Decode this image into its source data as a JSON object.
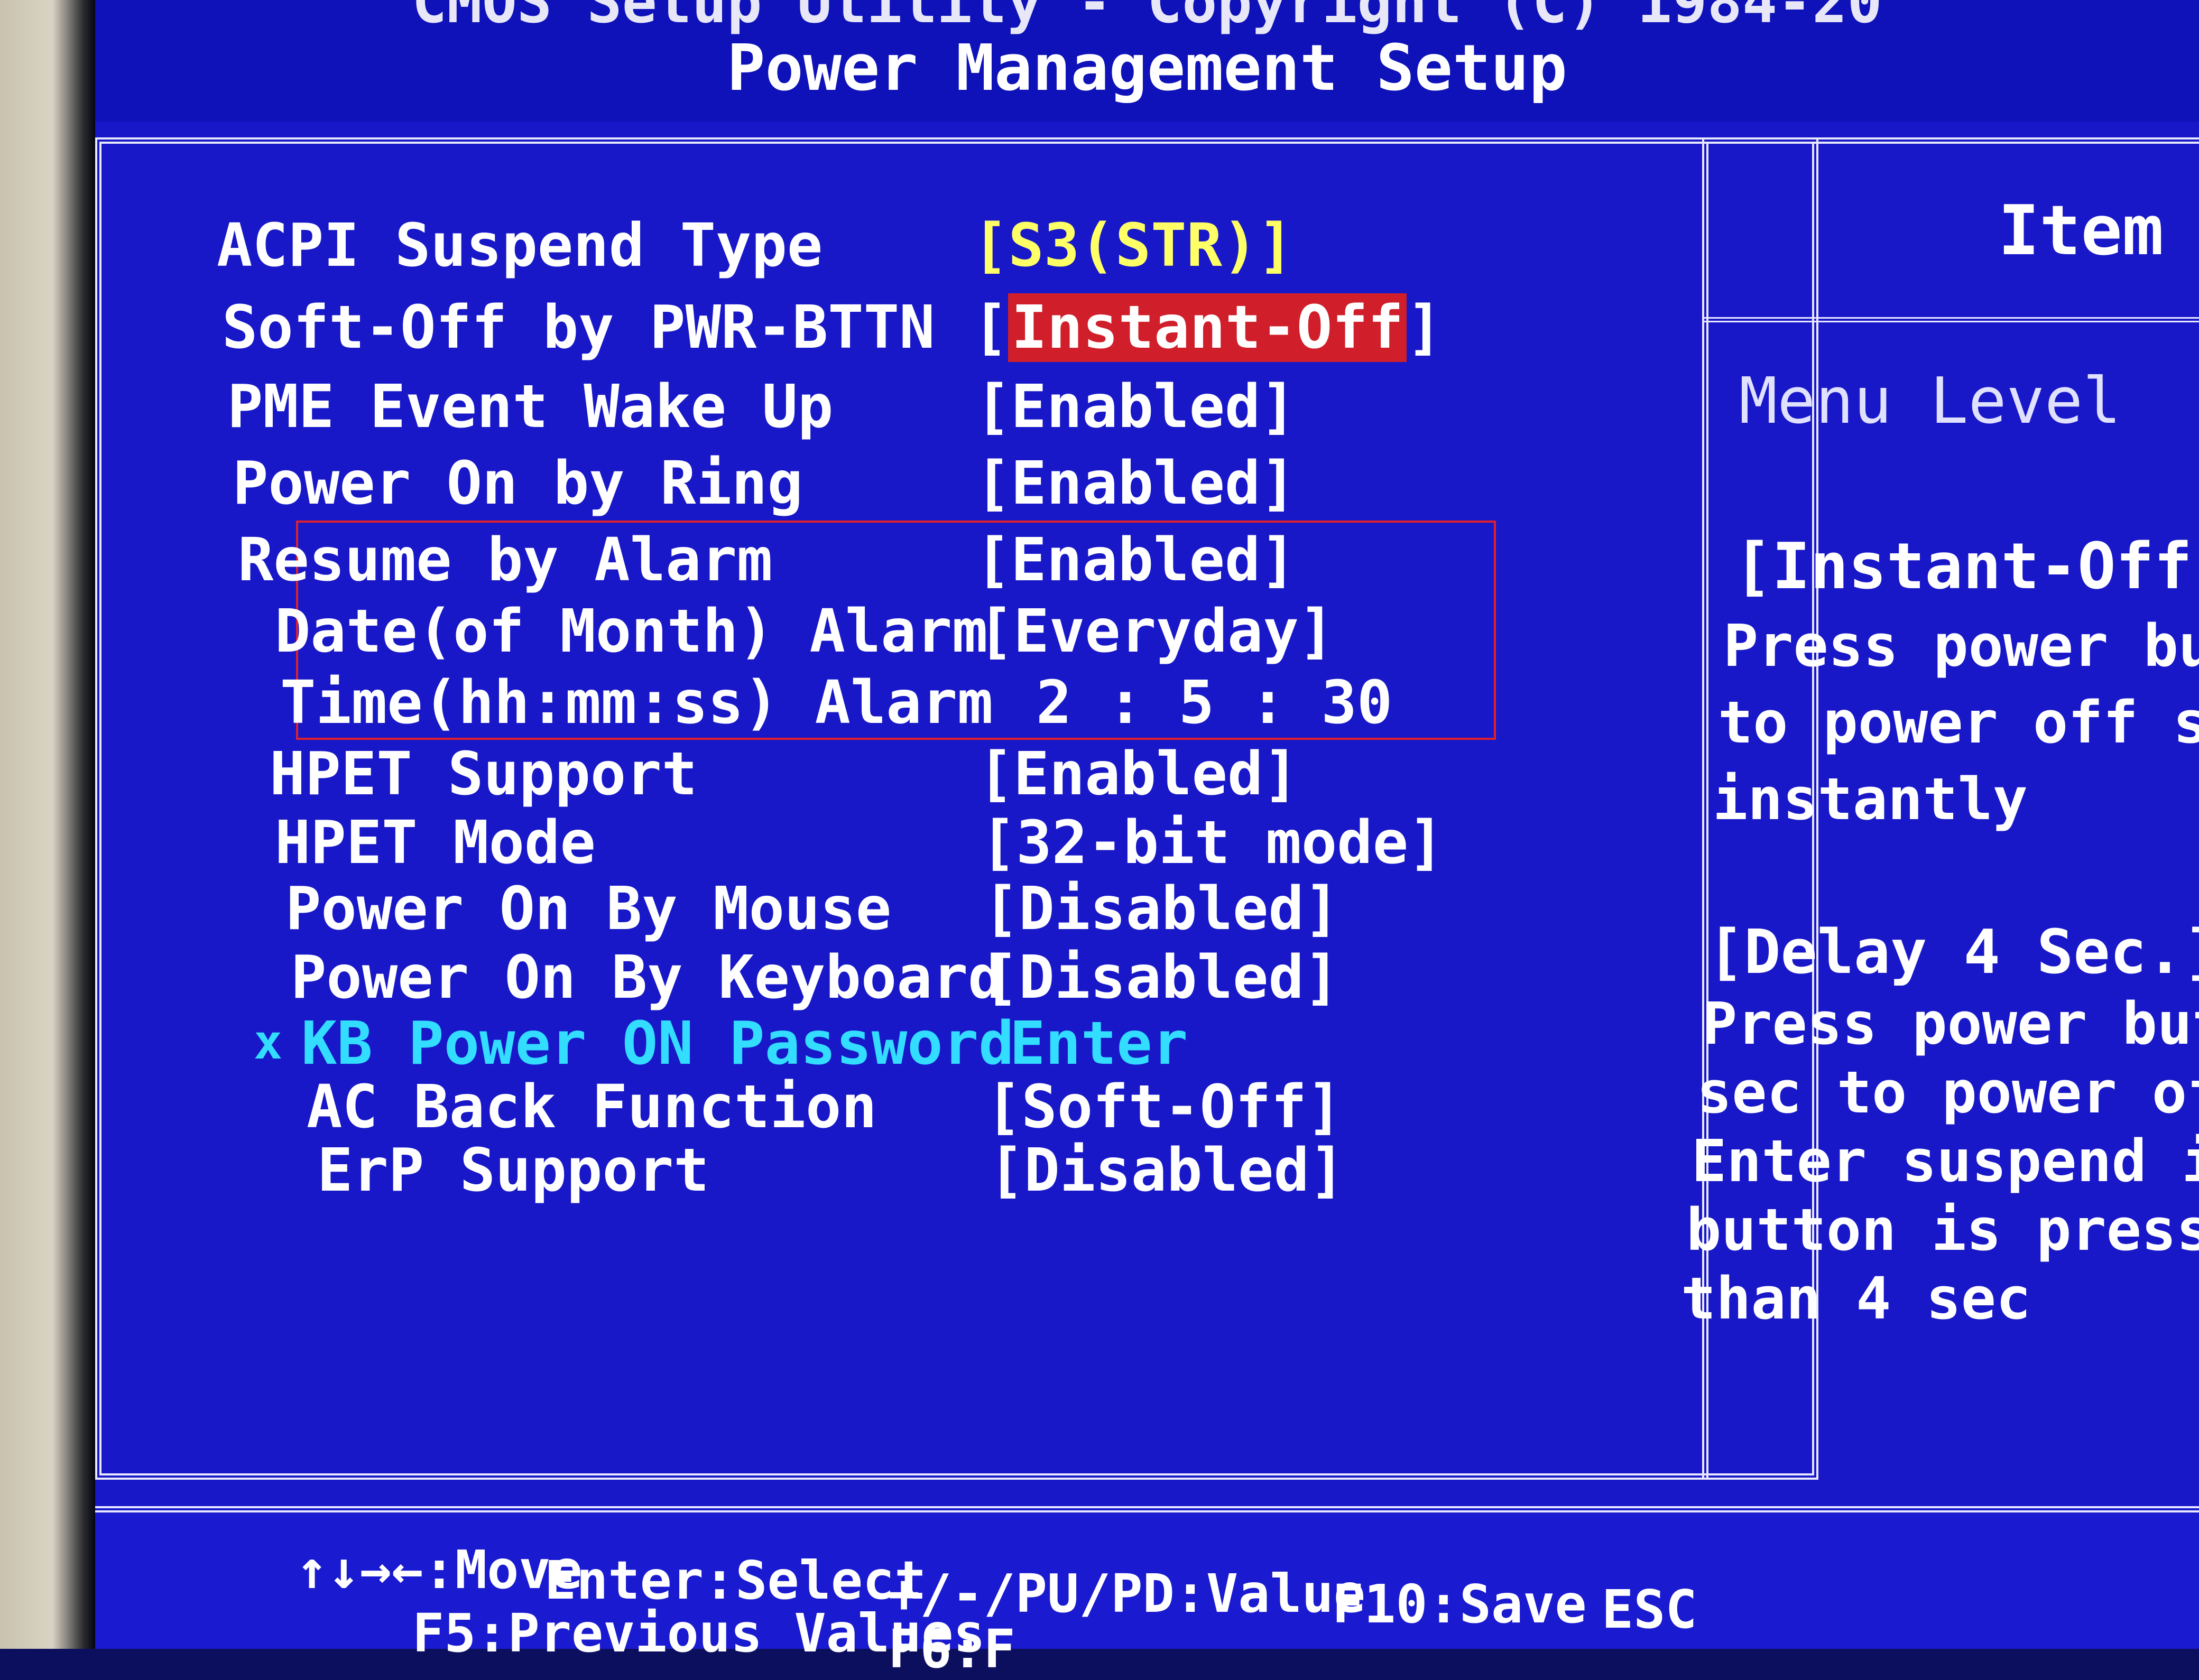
{
  "header": {
    "top_line": "CMOS Setup Utility - Copyright (C) 1984-20",
    "title": "Power Management Setup"
  },
  "settings": [
    {
      "label": "ACPI Suspend Type",
      "value": "[S3(STR)]"
    },
    {
      "label": "Soft-Off by PWR-BTTN",
      "value": "Instant-Off"
    },
    {
      "label": "PME Event Wake Up",
      "value": "[Enabled]"
    },
    {
      "label": "Power On by Ring",
      "value": "[Enabled]"
    },
    {
      "label": "Resume by Alarm",
      "value": "[Enabled]"
    },
    {
      "label": "Date(of Month) Alarm",
      "value": "[Everyday]"
    },
    {
      "label": "Time(hh:mm:ss) Alarm",
      "value": "2 : 5 : 30"
    },
    {
      "label": "HPET Support",
      "value": "[Enabled]"
    },
    {
      "label": "HPET Mode",
      "value": "[32-bit mode]"
    },
    {
      "label": "Power On By Mouse",
      "value": "[Disabled]"
    },
    {
      "label": "Power On By Keyboard",
      "value": "[Disabled]"
    },
    {
      "label": "KB Power ON Password",
      "value": "Enter",
      "marker": "x"
    },
    {
      "label": "AC Back Function",
      "value": "[Soft-Off]"
    },
    {
      "label": "ErP Support",
      "value": "[Disabled]"
    }
  ],
  "help": {
    "header": "Item H",
    "menu_level": "Menu Level",
    "menu_level_arrow": "▶",
    "lines": [
      "[Instant-Off]",
      "Press power but",
      "to power off sy",
      "instantly",
      "",
      "[Delay 4 Sec.]",
      "Press power butt",
      "sec to power off.",
      "Enter suspend if",
      "button is pressed",
      "than 4 sec"
    ]
  },
  "footer": {
    "move": "↑↓→←:Move",
    "select": "Enter:Select",
    "value": "+/-/PU/PD:Value",
    "save": "F10:Save",
    "esc": "ESC",
    "previous": "F5:Previous Values",
    "f6": "F6:F"
  },
  "colors": {
    "background": "#1818c8",
    "highlight": "#d01f2a",
    "disabled_item": "#33ddff",
    "acpi_value": "#ffff66",
    "annotation_box": "#e0202a"
  }
}
